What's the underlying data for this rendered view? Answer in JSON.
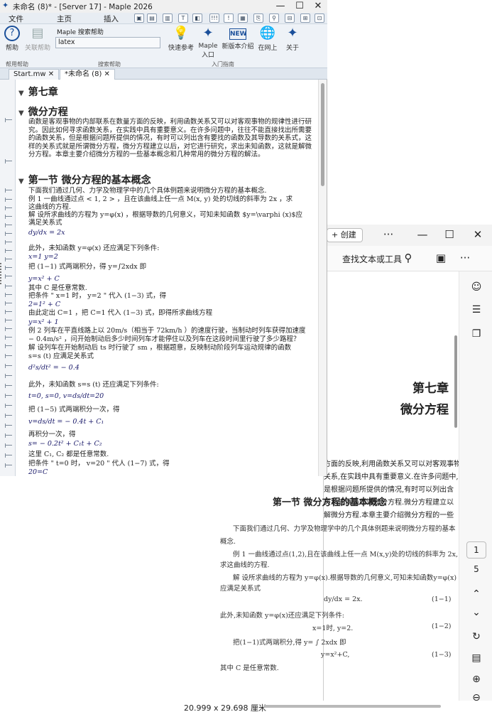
{
  "maple": {
    "title": "未命名 (8)* - [Server 17] - Maple 2026",
    "menu": [
      "文件",
      "主页",
      "插入"
    ],
    "ribbon": {
      "help": "帮助",
      "related_help": "关联帮助",
      "search_label": "Maple 搜索帮助",
      "search_value": "latex",
      "groups": [
        "帮用帮助",
        "搜索帮助",
        "入门指南"
      ],
      "quick_ref": "快速参考",
      "maple_portal": "Maple 入口",
      "whats_new": "新版本介绍",
      "online": "在网上",
      "about": "关于"
    },
    "tabs": [
      "Start.mw",
      "*未命名 (8)"
    ]
  },
  "doc": {
    "chapter": "第七章",
    "h1": "微分方程",
    "intro": "函数是客观事物的内部联系在数量方面的反映，利用函数关系又可以对客观事物的规律性进行研究。因此如何寻求函数关系，在实践中具有重要意义。在许多问题中，往往不能直接找出所需要的函数关系，但是根据问题所提供的情况，有时可以列出含有要找的函数及其导数的关系式，这样的关系式就是所谓微分方程，微分方程建立以后，对它进行研究，求出未知函数，这就是解微分方程。本章主要介绍微分方程的一些基本概念和几种常用的微分方程的解法。",
    "h2": "第一节 微分方程的基本概念",
    "lines": [
      "下面我们通过几何、力学及物理学中的几个具体例题来说明微分方程的基本概念.",
      "例 1  一曲线通过点  < 1, 2 > ，且在该曲线上任一点  M(x, y)  处的切线的斜率为  2x ，求",
      "这曲线的方程.",
      "解  设所求曲线的方程为  y=φ(x) ，根据导数的几何意义，可知未知函数  $y=\\varphi (x)$应",
      "满足关系式",
      "dy/dx = 2x",
      "此外，未知函数  y=φ(x)  还应满足下列条件:",
      "x=1   y=2",
      "把 (1−1) 式两端积分，得  y=∫2xdx  即",
      "y=x² + C",
      "其中  C  是任意常数.",
      "把条件 \" x=1  时， y=2 \" 代入 (1−3) 式，得",
      "2=1² + C",
      "由此定出  C=1 ，把  C=1  代入 (1−3) 式，即得所求曲线方程",
      "y=x² + 1",
      "例 2  列车在平直线路上以  20m/s（相当于  72km/h ）的速度行驶，当制动时列车获得加速度",
      "− 0.4m/s² ，问开始制动后多少时间列车才能停住以及列车在这段时间里行驶了多少路程？",
      "解  设列车在开始制动后  ts  时行驶了  sm ，根据题意，反映制动阶段列车运动规律的函数",
      "s=s (t)  应满足关系式",
      "d²s/dt² = − 0.4",
      "此外，未知函数  s=s (t)  还应满足下列条件:",
      "t=0,  s=0,  v=ds/dt=20",
      "把 (1−5) 式两端积分一次，得",
      "v=ds/dt = − 0.4t + C₁",
      "再积分一次，得",
      "s= − 0.2t² + C₁t + C₂",
      "这里  C₁, C₂  都是任意常数.",
      "把条件 \" t=0  时， v=20 \" 代人 (1−7) 式，得",
      "20=C"
    ]
  },
  "pdf": {
    "create": "创建",
    "find": "查找文本或工具",
    "chapter": "第七章",
    "chapter_sub": "微分方程",
    "frag": [
      "方面的反映,利用函数关系又可以对客观事物",
      "关系,在实践中具有重要意义.在许多问题中,",
      "是根据问题所提供的情况,有时可以列出含",
      "关系式就是所谓微分方程.微分方程建立以",
      "解微分方程.本章主要介绍微分方程的一些"
    ],
    "section": "第一节   微分方程的基本概念",
    "body": [
      "下面我们通过几何、力学及物理学中的几个具体例题来说明微分方程的基本",
      "概念.",
      "例 1   一曲线通过点(1,2),且在该曲线上任一点 M(x,y)处的切线的斜率为 2x,",
      "求这曲线的方程.",
      "解   设所求曲线的方程为 y=φ(x).根据导数的几何意义,可知未知函数y=φ(x)",
      "应满足关系式",
      "dy/dx = 2x.",
      "(1−1)",
      "此外,未知函数 y=φ(x)还应满足下列条件:",
      "x=1时,   y=2.",
      "(1−2)",
      "把(1−1)式两端积分,得 y= ∫ 2xdx 即",
      "y=x²+C,",
      "(1−3)",
      "其中 C 是任意常数."
    ],
    "pages": [
      "1",
      "5"
    ],
    "size": "20.999 x 29.698 厘米"
  }
}
